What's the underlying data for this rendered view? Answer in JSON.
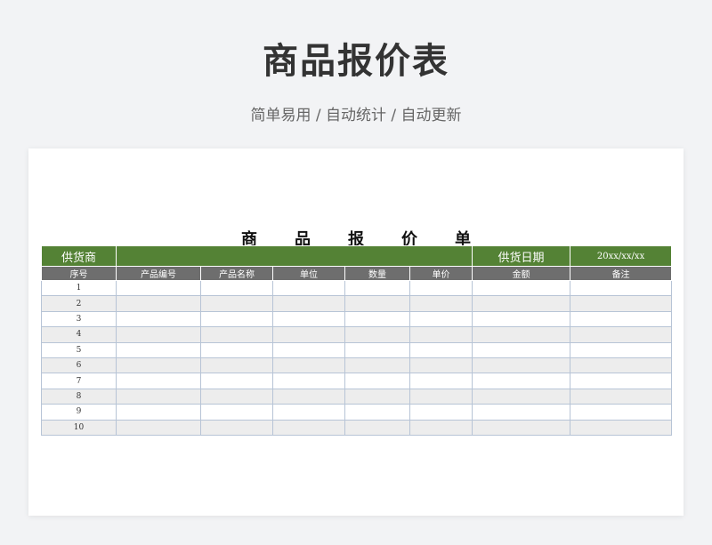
{
  "page": {
    "title": "商品报价表",
    "subtitle": "简单易用 / 自动统计 / 自动更新"
  },
  "sheet": {
    "title_chars": [
      "商",
      "品",
      "报",
      "价",
      "单"
    ],
    "supplier_label": "供货商",
    "supplier_value": "",
    "date_label": "供货日期",
    "date_value": "20xx/xx/xx",
    "columns": [
      "序号",
      "产品编号",
      "产品名称",
      "单位",
      "数量",
      "单价",
      "金额",
      "备注"
    ],
    "rows": [
      [
        "1",
        "",
        "",
        "",
        "",
        "",
        "",
        ""
      ],
      [
        "2",
        "",
        "",
        "",
        "",
        "",
        "",
        ""
      ],
      [
        "3",
        "",
        "",
        "",
        "",
        "",
        "",
        ""
      ],
      [
        "4",
        "",
        "",
        "",
        "",
        "",
        "",
        ""
      ],
      [
        "5",
        "",
        "",
        "",
        "",
        "",
        "",
        ""
      ],
      [
        "6",
        "",
        "",
        "",
        "",
        "",
        "",
        ""
      ],
      [
        "7",
        "",
        "",
        "",
        "",
        "",
        "",
        ""
      ],
      [
        "8",
        "",
        "",
        "",
        "",
        "",
        "",
        ""
      ],
      [
        "9",
        "",
        "",
        "",
        "",
        "",
        "",
        ""
      ],
      [
        "10",
        "",
        "",
        "",
        "",
        "",
        "",
        ""
      ]
    ]
  },
  "colors": {
    "accent_green": "#548235",
    "header_gray": "#6e6e6e",
    "stripe_gray": "#ededed"
  }
}
